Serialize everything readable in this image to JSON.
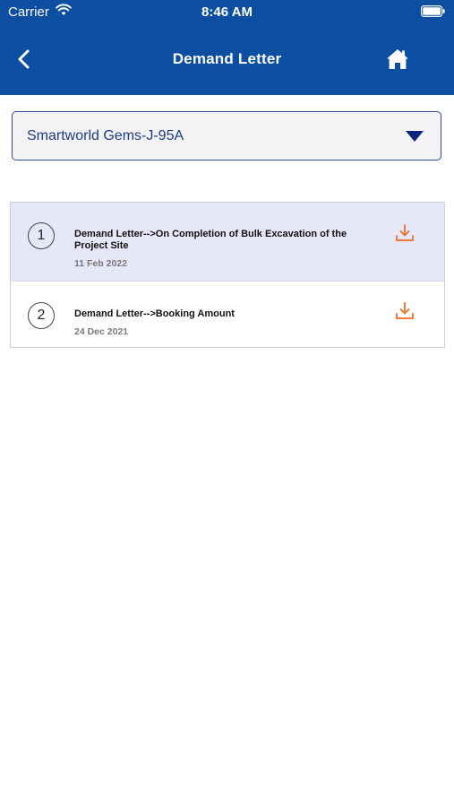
{
  "status_bar": {
    "carrier": "Carrier",
    "time": "8:46 AM"
  },
  "nav": {
    "title": "Demand Letter",
    "back_icon": "chevron-left-icon",
    "home_icon": "home-icon"
  },
  "project_select": {
    "selected": "Smartworld Gems-J-95A"
  },
  "letters": [
    {
      "index": "1",
      "title": "Demand Letter-->On Completion of Bulk Excavation of the Project Site",
      "date": "11 Feb 2022",
      "selected": true
    },
    {
      "index": "2",
      "title": "Demand Letter-->Booking Amount",
      "date": "24 Dec 2021",
      "selected": false
    }
  ],
  "colors": {
    "header_bg": "#0b4ea2",
    "accent_orange": "#ee7a3c",
    "selected_row_bg": "#e6e7f8",
    "select_text": "#1f3d86"
  }
}
